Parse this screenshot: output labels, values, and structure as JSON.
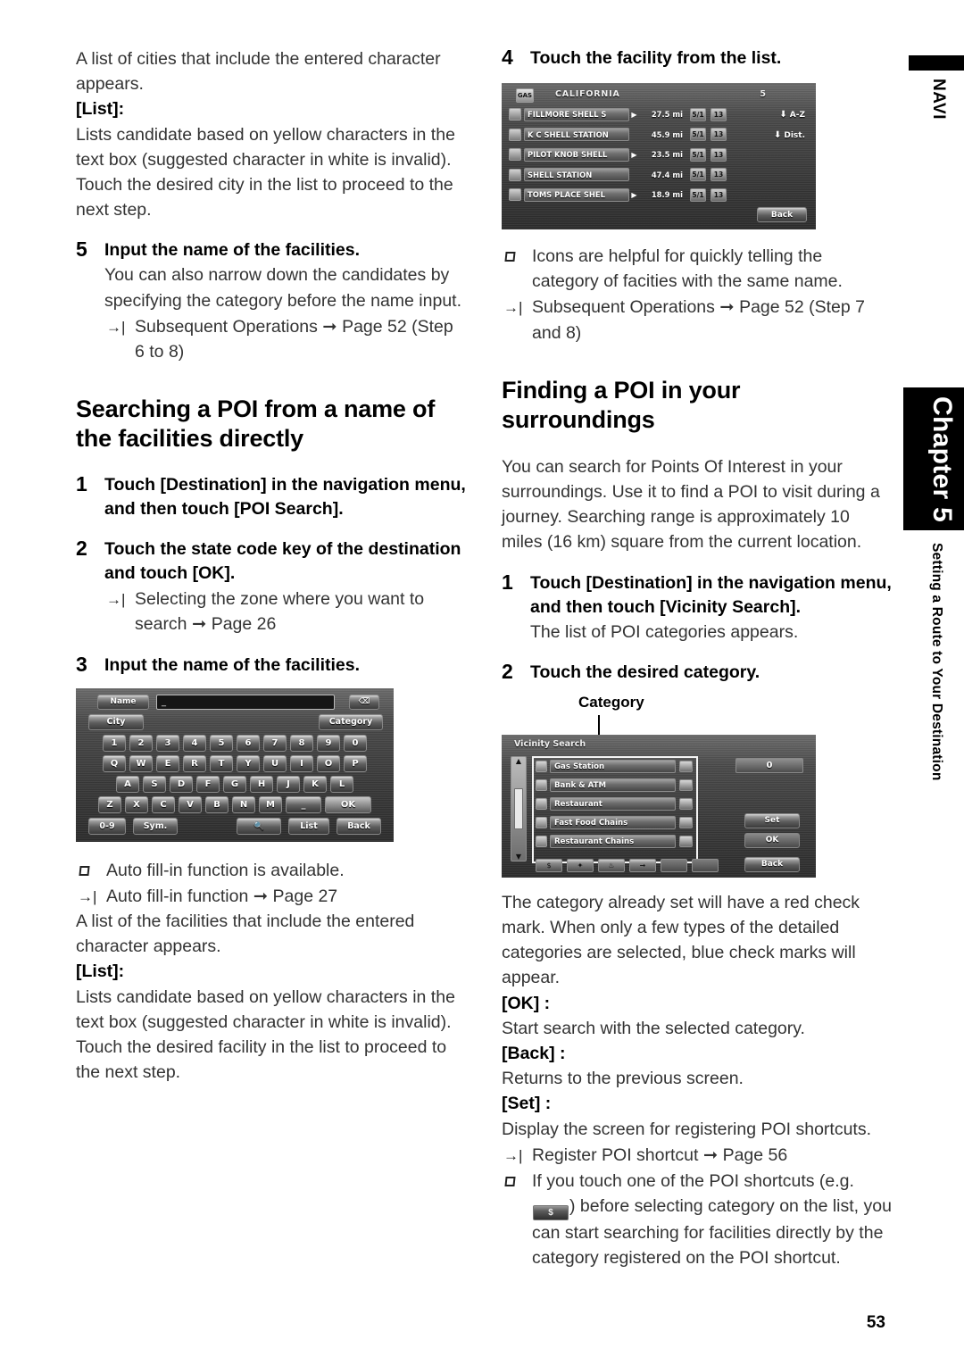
{
  "page": {
    "number": "53",
    "chapter_box": "Chapter 5",
    "chapter_subtitle": "Setting a Route to Your Destination",
    "navi_tab": "NAVI"
  },
  "left_column": {
    "intro_paragraph": "A list of cities that include the entered character appears.",
    "list_label": "[List]:",
    "list_description": "Lists candidate based on yellow characters in the text box (suggested character in white is invalid). Touch the desired city in the list to proceed to the next step.",
    "step5": {
      "num": "5",
      "title": "Input the name of the facilities.",
      "body": "You can also narrow down the candidates by specifying the category before the name input.",
      "note": "Subsequent Operations ➞ Page 52 (Step 6 to 8)"
    },
    "heading": "Searching a POI from a name of the facilities directly",
    "step1": {
      "num": "1",
      "title": "Touch [Destination] in the navigation menu, and then touch [POI Search]."
    },
    "step2": {
      "num": "2",
      "title": "Touch the state code key of the destination and touch [OK].",
      "note": "Selecting the zone where you want to search ➞ Page 26"
    },
    "step3": {
      "num": "3",
      "title": "Input the name of the facilities."
    },
    "note_autofill": "Auto fill-in function is available.",
    "note_autofill_ref": "Auto fill-in function ➞ Page 27",
    "facilities_paragraph": "A list of the facilities that include the entered character appears.",
    "list_label2": "[List]:",
    "list_description2": "Lists candidate based on yellow characters in the text box (suggested character in white is invalid). Touch the desired facility in the list to proceed to the next step."
  },
  "keyboard_screen": {
    "name_label": "Name",
    "input_value": "_",
    "delete_icon": "⌫",
    "city_button": "City",
    "category_button": "Category",
    "row_numbers": [
      "1",
      "2",
      "3",
      "4",
      "5",
      "6",
      "7",
      "8",
      "9",
      "0"
    ],
    "row_q": [
      "Q",
      "W",
      "E",
      "R",
      "T",
      "Y",
      "U",
      "I",
      "O",
      "P"
    ],
    "row_a": [
      "A",
      "S",
      "D",
      "F",
      "G",
      "H",
      "J",
      "K",
      "L"
    ],
    "row_z": [
      "Z",
      "X",
      "C",
      "V",
      "B",
      "N",
      "M"
    ],
    "space_key": "_",
    "ok_key": "OK",
    "num_mode": "0-9",
    "sym_key": "Sym.",
    "search_key": "🔍",
    "list_key": "List",
    "back_key": "Back"
  },
  "right_column": {
    "step4": {
      "num": "4",
      "title": "Touch the facility from the list."
    },
    "note_icons": "Icons are helpful for quickly telling the category of facities with the same name.",
    "note_subsequent": "Subsequent Operations ➞ Page 52 (Step 7 and 8)",
    "heading": "Finding a POI in your surroundings",
    "intro": "You can search for Points Of Interest in your surroundings. Use it to find a POI to visit during a journey. Searching range is approximately 10 miles (16 km) square from the current location.",
    "step1": {
      "num": "1",
      "title": "Touch [Destination] in the navigation menu, and then touch [Vicinity Search].",
      "body": "The list of POI categories appears."
    },
    "step2": {
      "num": "2",
      "title": "Touch the desired category."
    },
    "callout_label": "Category",
    "after_text": "The category already set will have a red check mark. When only a few types of the detailed categories are selected, blue check marks will appear.",
    "ok_label": "[OK] :",
    "ok_desc": "Start search with the selected category.",
    "back_label": "[Back] :",
    "back_desc": "Returns to the previous screen.",
    "set_label": "[Set] :",
    "set_desc": "Display the screen for registering POI shortcuts.",
    "note_register": "Register POI shortcut ➞ Page 56",
    "note_shortcut_a": "If you touch one of the POI shortcuts (e.g.",
    "note_shortcut_icon": "$",
    "note_shortcut_b": ") before selecting category on the list, you can start searching for facilities directly by the category registered on the POI shortcut."
  },
  "facility_list_screen": {
    "badge": "GAS",
    "title": "CALIFORNIA",
    "count": "5",
    "sort_az": "A-Z",
    "sort_dist": "Dist.",
    "back_label": "Back",
    "rows": [
      {
        "name": "FILLMORE SHELL S",
        "arrow": "▶",
        "distance": "27.5 mi",
        "tag1": "5/1",
        "tag2": "13"
      },
      {
        "name": "K C SHELL STATION",
        "arrow": "",
        "distance": "45.9 mi",
        "tag1": "5/1",
        "tag2": "13"
      },
      {
        "name": "PILOT KNOB SHELL",
        "arrow": "▶",
        "distance": "23.5 mi",
        "tag1": "5/1",
        "tag2": "13"
      },
      {
        "name": "SHELL STATION",
        "arrow": "",
        "distance": "47.4 mi",
        "tag1": "5/1",
        "tag2": "13"
      },
      {
        "name": "TOMS PLACE SHEL",
        "arrow": "▶",
        "distance": "18.9 mi",
        "tag1": "5/1",
        "tag2": "13"
      }
    ]
  },
  "vicinity_screen": {
    "title": "Vicinity Search",
    "count": "0",
    "set_label": "Set",
    "ok_label": "OK",
    "back_label": "Back",
    "categories": [
      "Gas Station",
      "Bank & ATM",
      "Restaurant",
      "Fast Food Chains",
      "Restaurant Chains"
    ],
    "shortcuts": [
      "$",
      "✦",
      "♨",
      "➞",
      "",
      ""
    ]
  }
}
